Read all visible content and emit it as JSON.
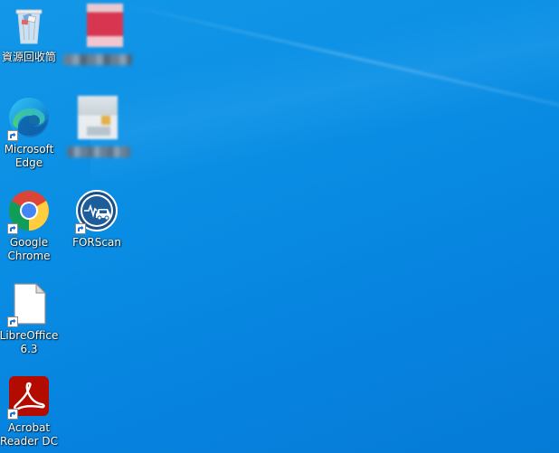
{
  "desktop": {
    "background_color": "#0a8fe4",
    "icons": [
      {
        "label": "資源回收筒",
        "icon": "recycle-bin-icon"
      },
      {
        "label": "",
        "icon": "blurred-icon"
      },
      {
        "label": "Microsoft Edge",
        "icon": "edge-icon"
      },
      {
        "label": "",
        "icon": "blurred-icon"
      },
      {
        "label": "Google Chrome",
        "icon": "chrome-icon"
      },
      {
        "label": "FORScan",
        "icon": "forscan-icon"
      },
      {
        "label": "LibreOffice 6.3",
        "icon": "libreoffice-icon"
      },
      {
        "label": "Acrobat Reader DC",
        "icon": "acrobat-reader-icon"
      }
    ]
  }
}
